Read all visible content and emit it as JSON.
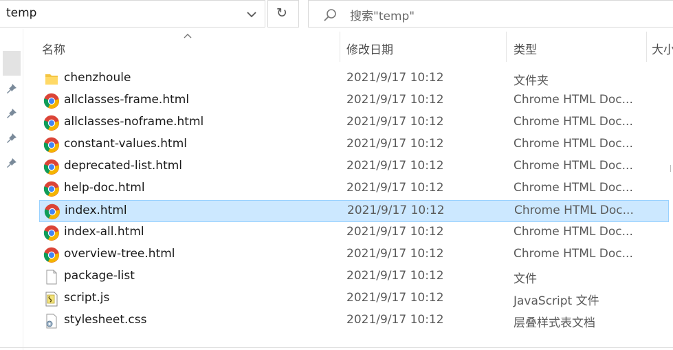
{
  "address_bar": {
    "path": "temp"
  },
  "search": {
    "placeholder": "搜索\"temp\""
  },
  "columns": {
    "name": "名称",
    "date": "修改日期",
    "type": "类型",
    "size": "大小"
  },
  "files": [
    {
      "name": "chenzhoule",
      "date": "2021/9/17 10:12",
      "type": "文件夹",
      "icon": "folder-icon"
    },
    {
      "name": "allclasses-frame.html",
      "date": "2021/9/17 10:12",
      "type": "Chrome HTML Doc...",
      "icon": "chrome-icon"
    },
    {
      "name": "allclasses-noframe.html",
      "date": "2021/9/17 10:12",
      "type": "Chrome HTML Doc...",
      "icon": "chrome-icon"
    },
    {
      "name": "constant-values.html",
      "date": "2021/9/17 10:12",
      "type": "Chrome HTML Doc...",
      "icon": "chrome-icon"
    },
    {
      "name": "deprecated-list.html",
      "date": "2021/9/17 10:12",
      "type": "Chrome HTML Doc...",
      "icon": "chrome-icon"
    },
    {
      "name": "help-doc.html",
      "date": "2021/9/17 10:12",
      "type": "Chrome HTML Doc...",
      "icon": "chrome-icon"
    },
    {
      "name": "index.html",
      "date": "2021/9/17 10:12",
      "type": "Chrome HTML Doc...",
      "icon": "chrome-icon",
      "selected": true
    },
    {
      "name": "index-all.html",
      "date": "2021/9/17 10:12",
      "type": "Chrome HTML Doc...",
      "icon": "chrome-icon"
    },
    {
      "name": "overview-tree.html",
      "date": "2021/9/17 10:12",
      "type": "Chrome HTML Doc...",
      "icon": "chrome-icon"
    },
    {
      "name": "package-list",
      "date": "2021/9/17 10:12",
      "type": "文件",
      "icon": "blank-file-icon"
    },
    {
      "name": "script.js",
      "date": "2021/9/17 10:12",
      "type": "JavaScript 文件",
      "icon": "javascript-file-icon"
    },
    {
      "name": "stylesheet.css",
      "date": "2021/9/17 10:12",
      "type": "层叠样式表文档",
      "icon": "css-file-icon"
    }
  ],
  "colors": {
    "selection_fill": "#cce8ff",
    "selection_border": "#99d1ff"
  }
}
